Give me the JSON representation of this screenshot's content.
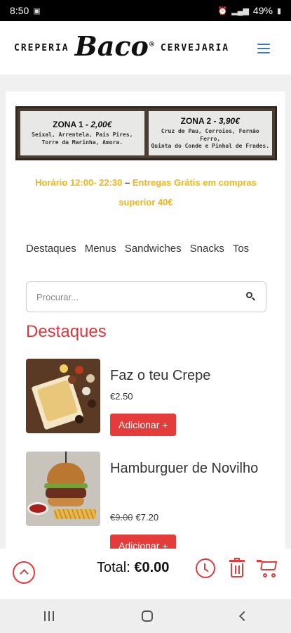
{
  "status_bar": {
    "time": "8:50",
    "battery": "49%"
  },
  "header": {
    "brand_left": "CREPERIA",
    "brand_logo": "Baco",
    "brand_registered": "®",
    "brand_right": "CERVEJARIA"
  },
  "banner": {
    "zones": [
      {
        "title": "ZONA 1 - ",
        "price": "2,00€",
        "places_line1": "Seixal, Arrentela, Pais Pires,",
        "places_line2": "Torre da Marinha, Amora."
      },
      {
        "title": "ZONA 2 - ",
        "price": "3,90€",
        "places_line1": "Cruz de Pau, Corroios, Fernão Ferro,",
        "places_line2": "Quinta do Conde e Pinhal de Frades."
      }
    ]
  },
  "info": {
    "hours": "Horário 12:00- 22:30",
    "dash": " – ",
    "delivery": "Entregas Grátis em compras superior 40€"
  },
  "categories": [
    "Destaques",
    "Menus",
    "Sandwiches",
    "Snacks",
    "Tos"
  ],
  "search": {
    "placeholder": "Procurar..."
  },
  "section_title": "Destaques",
  "products": [
    {
      "name": "Faz o teu Crepe",
      "old_price": "",
      "price": "€2.50",
      "button": "Adicionar +"
    },
    {
      "name": "Hamburguer de Novilho",
      "old_price": "€9.00",
      "price": "€7.20",
      "button": "Adicionar +"
    }
  ],
  "footer": {
    "total_label": "Total:",
    "total_value": "€0.00"
  },
  "colors": {
    "accent": "#e43b3b",
    "hours_yellow": "#f2b516",
    "menu_blue": "#3a7bbf"
  }
}
